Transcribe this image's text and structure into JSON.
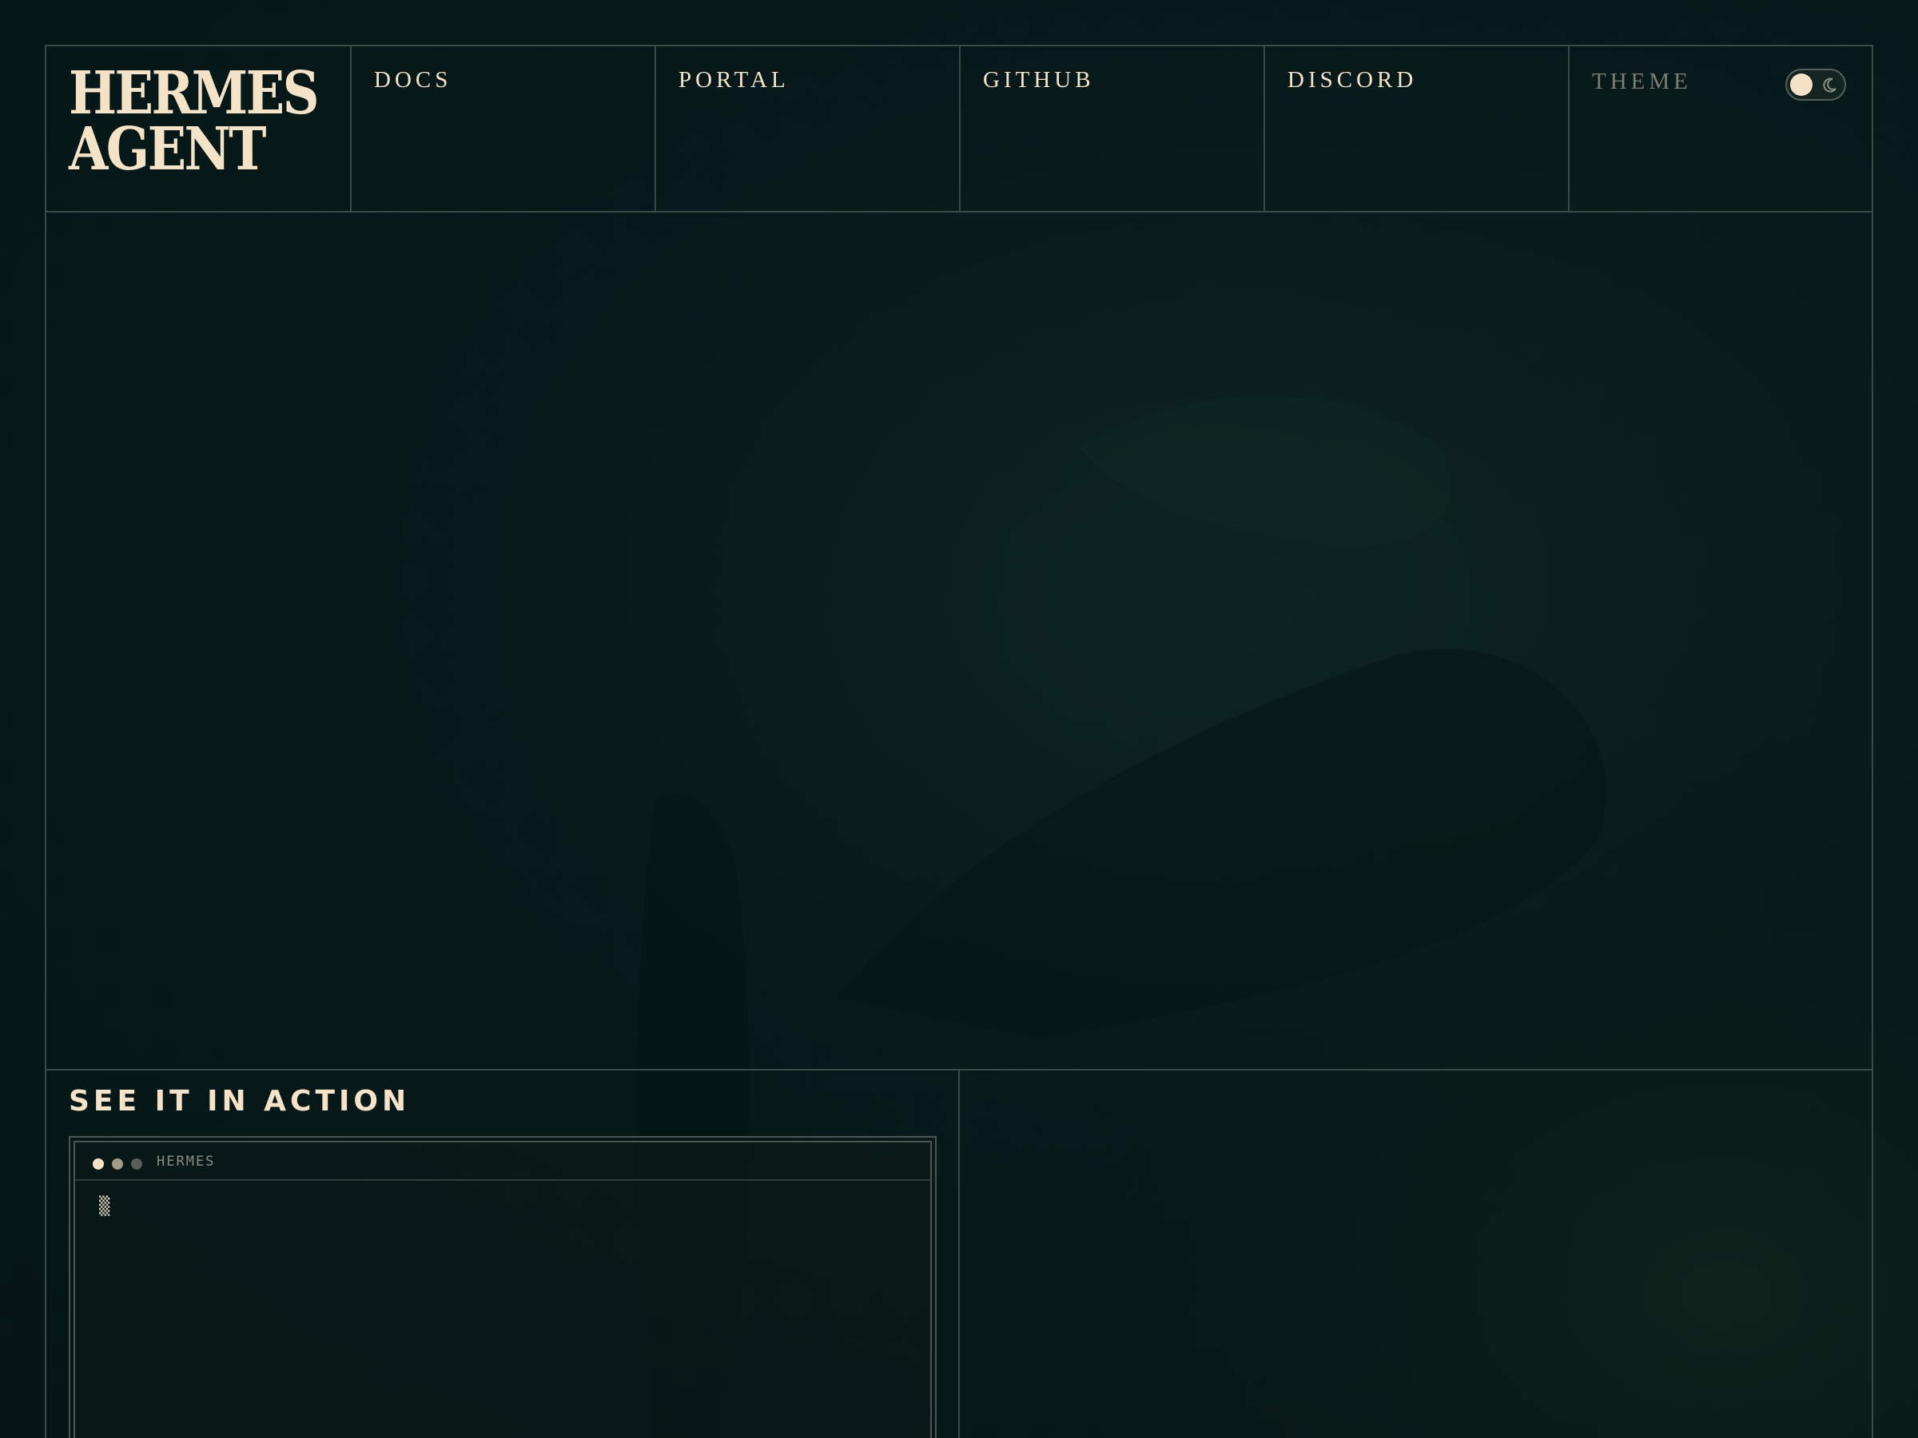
{
  "brand": {
    "line1": "HERMES",
    "line2": "AGENT"
  },
  "nav": {
    "links": [
      {
        "label": "DOCS"
      },
      {
        "label": "PORTAL"
      },
      {
        "label": "GITHUB"
      },
      {
        "label": "DISCORD"
      }
    ],
    "theme_label": "THEME",
    "theme_toggle": {
      "state": "light"
    }
  },
  "demo": {
    "title": "SEE IT IN ACTION",
    "terminal": {
      "title": "HERMES",
      "cursor": "▒"
    }
  },
  "colors": {
    "background": "#071a1a",
    "accent": "#f5e3c8",
    "border": "#3a4a44",
    "muted": "#7d7d72"
  }
}
